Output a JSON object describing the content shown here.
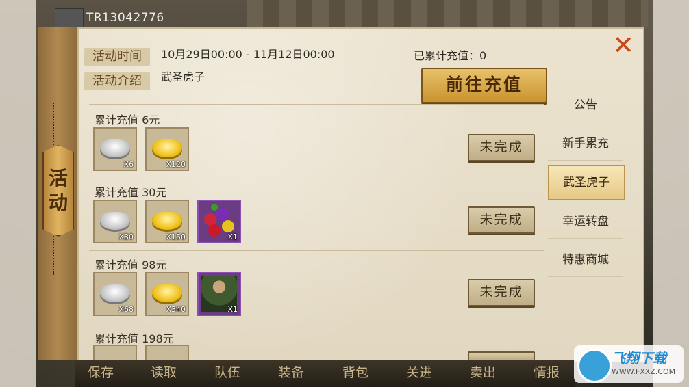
{
  "player": {
    "id": "TR13042776"
  },
  "side_tab": {
    "chars": [
      "活",
      "动"
    ]
  },
  "header": {
    "time_label": "活动时间",
    "time_value": "10月29日00:00 - 11月12日00:00",
    "intro_label": "活动介绍",
    "intro_value": "武圣虎子",
    "accumulated": "已累计充值：0",
    "charge_button": "前往充值"
  },
  "rows": [
    {
      "title": "累计充值  6元",
      "status": "未完成",
      "rewards": [
        {
          "icon": "silver-ingot",
          "qty": "X6"
        },
        {
          "icon": "gold-ingot",
          "qty": "X120"
        }
      ]
    },
    {
      "title": "累计充值  30元",
      "status": "未完成",
      "rewards": [
        {
          "icon": "silver-ingot",
          "qty": "X30"
        },
        {
          "icon": "gold-ingot",
          "qty": "X150"
        },
        {
          "icon": "fruit-basket",
          "qty": "X1"
        }
      ]
    },
    {
      "title": "累计充值  98元",
      "status": "未完成",
      "rewards": [
        {
          "icon": "silver-ingot",
          "qty": "X68"
        },
        {
          "icon": "gold-ingot",
          "qty": "X340"
        },
        {
          "icon": "hero-portrait",
          "qty": "X1"
        }
      ]
    },
    {
      "title": "累计充值  198元"
    }
  ],
  "nav": [
    {
      "label": "公告",
      "active": false
    },
    {
      "label": "新手累充",
      "active": false
    },
    {
      "label": "武圣虎子",
      "active": true
    },
    {
      "label": "幸运转盘",
      "active": false
    },
    {
      "label": "特惠商城",
      "active": false
    }
  ],
  "bottom_bar": [
    "保存",
    "读取",
    "队伍",
    "装备",
    "背包",
    "关进",
    "卖出",
    "情报"
  ],
  "watermark": {
    "title": "飞翔下载",
    "url": "WWW.FXXZ.COM"
  },
  "colors": {
    "accent_gold": "#c9932f",
    "close_red": "#c54b1b",
    "panel_bg": "#e7dec9"
  }
}
